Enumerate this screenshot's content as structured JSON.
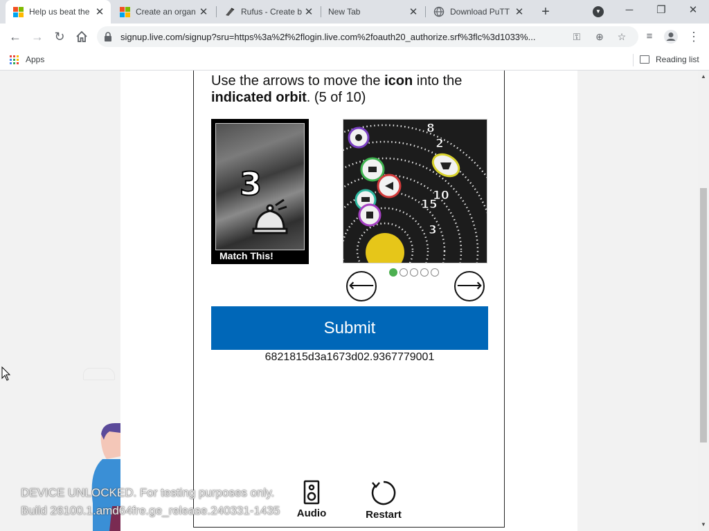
{
  "browser": {
    "tabs": [
      {
        "title": "Help us beat the",
        "favicon": "microsoft-logo",
        "active": true
      },
      {
        "title": "Create an organ",
        "favicon": "microsoft-logo",
        "active": false
      },
      {
        "title": "Rufus - Create b",
        "favicon": "rufus-icon",
        "active": false
      },
      {
        "title": "New Tab",
        "favicon": "",
        "active": false
      },
      {
        "title": "Download PuTT",
        "favicon": "globe-icon",
        "active": false
      }
    ],
    "url": "signup.live.com/signup?sru=https%3a%2f%2flogin.live.com%2foauth20_authorize.srf%3flc%3d1033%...",
    "bookmarks": {
      "apps_label": "Apps",
      "reading_list_label": "Reading list"
    }
  },
  "captcha": {
    "instruction": {
      "part1": "Use the arrows to move the ",
      "bold1": "icon",
      "part2": " into the ",
      "bold2": "indicated orbit",
      "part3": ". (5 of 10)"
    },
    "match": {
      "number": "3",
      "icon": "bell-icon",
      "label": "Match This!"
    },
    "orbit_labels": [
      "8",
      "2",
      "10",
      "15",
      "3"
    ],
    "pager": {
      "total": 5,
      "active_index": 0
    },
    "submit_label": "Submit",
    "token": "6821815d3a1673d02.9367779001",
    "audio_label": "Audio",
    "restart_label": "Restart"
  },
  "watermark": {
    "line1": "DEVICE UNLOCKED. For testing purposes only.",
    "line2": "Build 26100.1.amd64fre.ge_release.240331-1435"
  },
  "colors": {
    "submit_bg": "#0067b8",
    "pager_active": "#4caf50",
    "sun": "#e6c619"
  }
}
